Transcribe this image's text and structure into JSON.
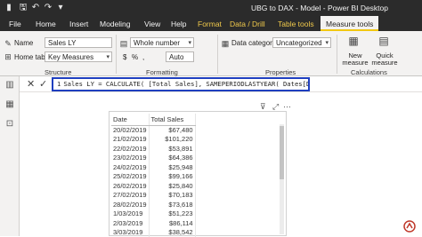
{
  "titlebar": {
    "title": "UBG to DAX - Model - Power BI Desktop"
  },
  "tabs": {
    "file": "File",
    "home": "Home",
    "insert": "Insert",
    "modeling": "Modeling",
    "view": "View",
    "help": "Help",
    "format": "Format",
    "data_drill": "Data / Drill",
    "table_tools": "Table tools",
    "measure_tools": "Measure tools"
  },
  "ribbon": {
    "name_label": "Name",
    "name_value": "Sales LY",
    "home_table_label": "Home table",
    "home_table_value": "Key Measures",
    "structure_label": "Structure",
    "format_value": "Whole number",
    "formatting_label": "Formatting",
    "currency": "$",
    "percent": "%",
    "comma": ",",
    "decimals": "Auto",
    "data_category_label": "Data category",
    "data_category_value": "Uncategorized",
    "properties_label": "Properties",
    "new_measure": "New measure",
    "quick_measure": "Quick measure",
    "calculations_label": "Calculations"
  },
  "formula": {
    "line_number": "1",
    "text": "Sales LY = CALCULATE( [Total Sales], SAMEPERIODLASTYEAR( Dates[Date] ) )"
  },
  "table": {
    "headers": [
      "Date",
      "Total Sales"
    ],
    "rows": [
      [
        "20/02/2019",
        "$67,480"
      ],
      [
        "21/02/2019",
        "$101,220"
      ],
      [
        "22/02/2019",
        "$53,891"
      ],
      [
        "23/02/2019",
        "$64,386"
      ],
      [
        "24/02/2019",
        "$25,948"
      ],
      [
        "25/02/2019",
        "$99,166"
      ],
      [
        "26/02/2019",
        "$25,840"
      ],
      [
        "27/02/2019",
        "$70,183"
      ],
      [
        "28/02/2019",
        "$73,618"
      ],
      [
        "1/03/2019",
        "$51,223"
      ],
      [
        "2/03/2019",
        "$86,114"
      ],
      [
        "3/03/2019",
        "$38,542"
      ]
    ]
  },
  "colors": {
    "accent": "#f2c811",
    "formula_border": "#1f3fbf",
    "dark_chrome": "#2b2b2b"
  }
}
